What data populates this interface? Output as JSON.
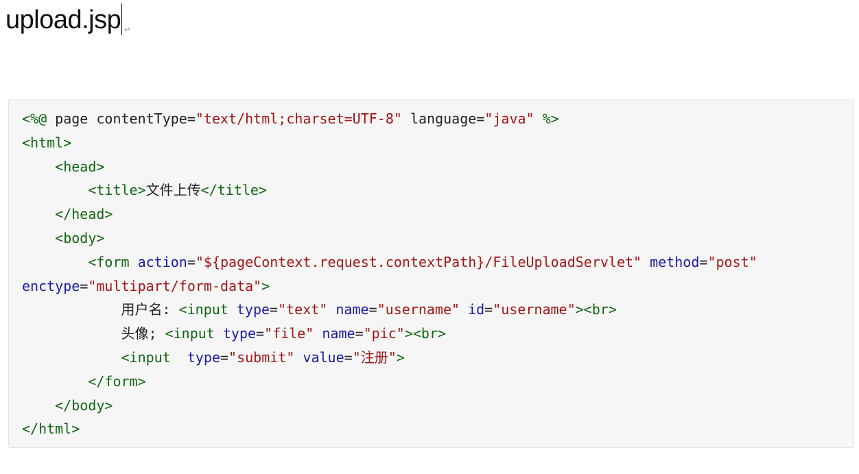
{
  "document": {
    "heading": "upload.jsp",
    "paragraph_mark": "↵"
  },
  "code": {
    "language": "jsp",
    "colors": {
      "tag": "#116611",
      "attribute": "#1a1aa6",
      "string": "#a31515",
      "text": "#222222",
      "background": "#f6f6f6"
    },
    "lines": [
      [
        {
          "t": "tag",
          "s": "<%@ "
        },
        {
          "t": "text",
          "s": "page contentType"
        },
        {
          "t": "punc",
          "s": "="
        },
        {
          "t": "str",
          "s": "\"text/html;charset=UTF-8\""
        },
        {
          "t": "text",
          "s": " language"
        },
        {
          "t": "punc",
          "s": "="
        },
        {
          "t": "str",
          "s": "\"java\""
        },
        {
          "t": "text",
          "s": " "
        },
        {
          "t": "tag",
          "s": "%>"
        }
      ],
      [
        {
          "t": "tag",
          "s": "<html>"
        }
      ],
      [
        {
          "t": "text",
          "s": "    "
        },
        {
          "t": "tag",
          "s": "<head>"
        }
      ],
      [
        {
          "t": "text",
          "s": "        "
        },
        {
          "t": "tag",
          "s": "<title>"
        },
        {
          "t": "text",
          "s": "文件上传"
        },
        {
          "t": "tag",
          "s": "</title>"
        }
      ],
      [
        {
          "t": "text",
          "s": "    "
        },
        {
          "t": "tag",
          "s": "</head>"
        }
      ],
      [
        {
          "t": "text",
          "s": "    "
        },
        {
          "t": "tag",
          "s": "<body>"
        }
      ],
      [
        {
          "t": "text",
          "s": "        "
        },
        {
          "t": "tag",
          "s": "<form "
        },
        {
          "t": "attr",
          "s": "action"
        },
        {
          "t": "punc",
          "s": "="
        },
        {
          "t": "str",
          "s": "\"${pageContext.request.contextPath}/FileUploadServlet\""
        },
        {
          "t": "text",
          "s": " "
        },
        {
          "t": "attr",
          "s": "method"
        },
        {
          "t": "punc",
          "s": "="
        },
        {
          "t": "str",
          "s": "\"post\""
        }
      ],
      [
        {
          "t": "attr",
          "s": "enctype"
        },
        {
          "t": "punc",
          "s": "="
        },
        {
          "t": "str",
          "s": "\"multipart/form-data\""
        },
        {
          "t": "tag",
          "s": ">"
        }
      ],
      [
        {
          "t": "text",
          "s": "            用户名: "
        },
        {
          "t": "tag",
          "s": "<input "
        },
        {
          "t": "attr",
          "s": "type"
        },
        {
          "t": "punc",
          "s": "="
        },
        {
          "t": "str",
          "s": "\"text\""
        },
        {
          "t": "text",
          "s": " "
        },
        {
          "t": "attr",
          "s": "name"
        },
        {
          "t": "punc",
          "s": "="
        },
        {
          "t": "str",
          "s": "\"username\""
        },
        {
          "t": "text",
          "s": " "
        },
        {
          "t": "attr",
          "s": "id"
        },
        {
          "t": "punc",
          "s": "="
        },
        {
          "t": "str",
          "s": "\"username\""
        },
        {
          "t": "tag",
          "s": "><br>"
        }
      ],
      [
        {
          "t": "text",
          "s": "            头像; "
        },
        {
          "t": "tag",
          "s": "<input "
        },
        {
          "t": "attr",
          "s": "type"
        },
        {
          "t": "punc",
          "s": "="
        },
        {
          "t": "str",
          "s": "\"file\""
        },
        {
          "t": "text",
          "s": " "
        },
        {
          "t": "attr",
          "s": "name"
        },
        {
          "t": "punc",
          "s": "="
        },
        {
          "t": "str",
          "s": "\"pic\""
        },
        {
          "t": "tag",
          "s": "><br>"
        }
      ],
      [
        {
          "t": "text",
          "s": "            "
        },
        {
          "t": "tag",
          "s": "<input  "
        },
        {
          "t": "attr",
          "s": "type"
        },
        {
          "t": "punc",
          "s": "="
        },
        {
          "t": "str",
          "s": "\"submit\""
        },
        {
          "t": "text",
          "s": " "
        },
        {
          "t": "attr",
          "s": "value"
        },
        {
          "t": "punc",
          "s": "="
        },
        {
          "t": "str",
          "s": "\"注册\""
        },
        {
          "t": "tag",
          "s": ">"
        }
      ],
      [
        {
          "t": "text",
          "s": "        "
        },
        {
          "t": "tag",
          "s": "</form>"
        }
      ],
      [
        {
          "t": "text",
          "s": "    "
        },
        {
          "t": "tag",
          "s": "</body>"
        }
      ],
      [
        {
          "t": "tag",
          "s": "</html>"
        }
      ]
    ]
  }
}
